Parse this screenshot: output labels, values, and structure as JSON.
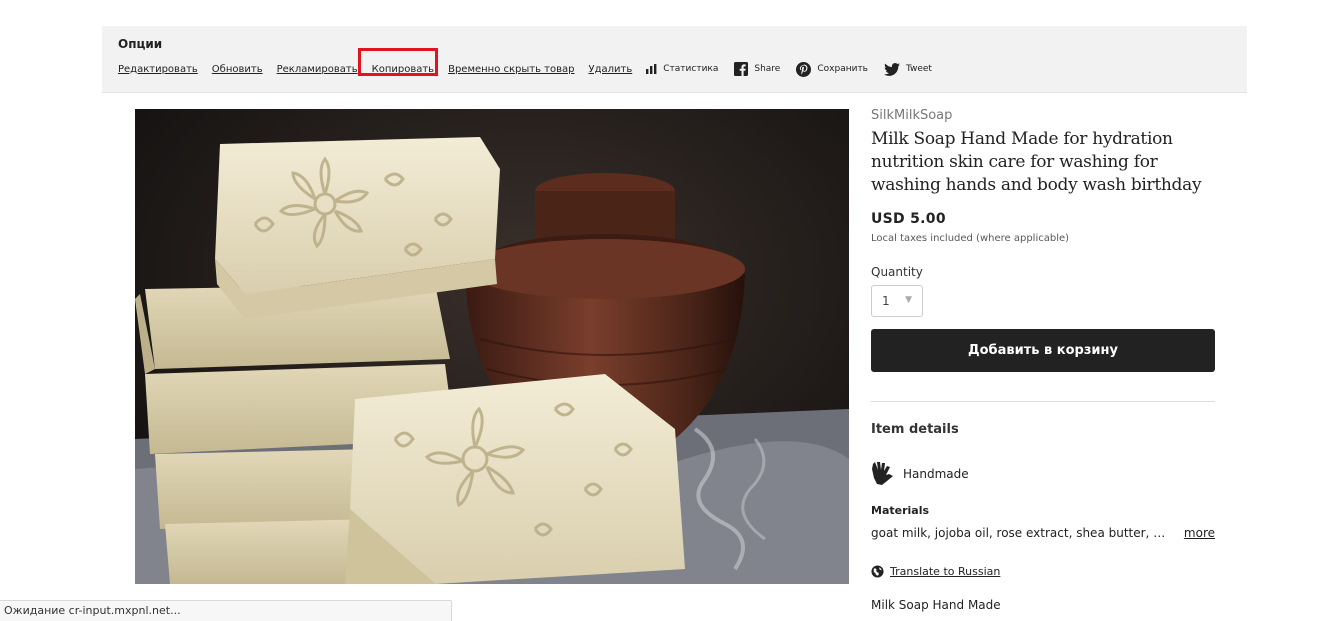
{
  "options": {
    "title": "Опции",
    "links": {
      "edit": "Редактировать",
      "renew": "Обновить",
      "advertise": "Рекламировать",
      "copy": "Копировать",
      "hide": "Временно скрыть товар",
      "delete": "Удалить"
    },
    "actions": {
      "stats": "Статистика",
      "share": "Share",
      "save": "Сохранить",
      "tweet": "Tweet"
    }
  },
  "product": {
    "shop_name": "SilkMilkSoap",
    "title": "Milk Soap Hand Made for hydration nutrition skin care for washing for washing hands and body wash birthday",
    "price": "USD 5.00",
    "tax_note": "Local taxes included (where applicable)",
    "quantity_label": "Quantity",
    "quantity_value": "1",
    "add_to_cart": "Добавить в корзину",
    "details_heading": "Item details",
    "handmade": "Handmade",
    "materials_label": "Materials",
    "materials": "goat milk, jojoba oil, rose extract, shea butter, m...",
    "more": "more",
    "translate": "Translate to Russian",
    "description_cut": "Milk Soap Hand Made"
  },
  "status_bar": {
    "text": "Ожидание cr-input.mxpnl.net..."
  }
}
